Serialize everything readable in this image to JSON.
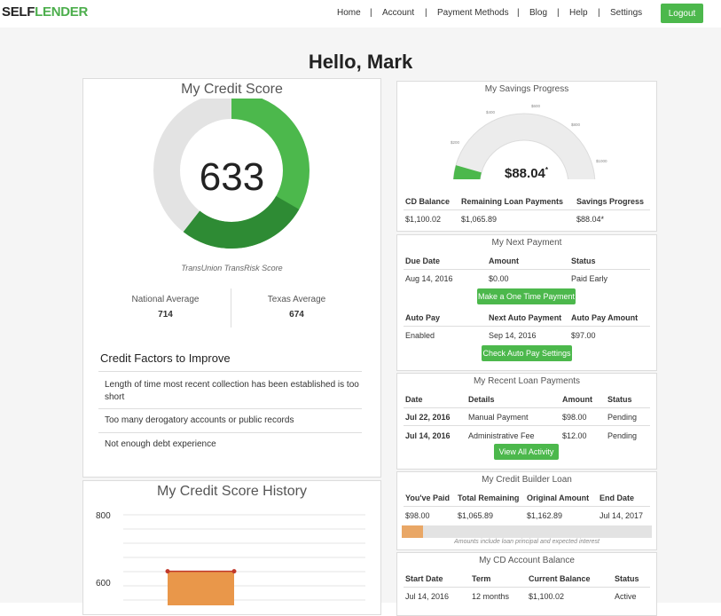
{
  "brand": {
    "part1": "SELF",
    "part2": "LENDER"
  },
  "nav": {
    "items": [
      "Home",
      "Account",
      "Payment Methods",
      "Blog",
      "Help",
      "Settings"
    ],
    "logout": "Logout"
  },
  "greeting": "Hello, Mark",
  "credit_score": {
    "title": "My Credit Score",
    "score": "633",
    "source": "TransUnion TransRisk Score",
    "national_label": "National Average",
    "national_value": "714",
    "texas_label": "Texas Average",
    "texas_value": "674",
    "factors_title": "Credit Factors to Improve",
    "factors": [
      "Length of time most recent collection has been established is too short",
      "Too many derogatory accounts or public records",
      "Not enough debt experience"
    ]
  },
  "history": {
    "title": "My Credit Score History",
    "y_labels": [
      "800",
      "600"
    ]
  },
  "chart_data": {
    "type": "line",
    "title": "My Credit Score History",
    "yticks": [
      800,
      600
    ],
    "series": [
      {
        "values": [
          633,
          633
        ]
      }
    ],
    "ylim": [
      590,
      800
    ]
  },
  "savings": {
    "title": "My Savings Progress",
    "gauge_value": "$88.04",
    "gauge_mark": "*",
    "gauge_ticks": [
      "$200",
      "$400",
      "$600",
      "$800",
      "$1000"
    ],
    "progress": 0.088,
    "headers": [
      "CD Balance",
      "Remaining Loan Payments",
      "Savings Progress"
    ],
    "values": [
      "$1,100.02",
      "$1,065.89",
      "$88.04*"
    ]
  },
  "next_payment": {
    "title": "My Next Payment",
    "headers": [
      "Due Date",
      "Amount",
      "Status"
    ],
    "values": [
      "Aug 14, 2016",
      "$0.00",
      "Paid Early"
    ],
    "button": "Make a One Time Payment",
    "headers2": [
      "Auto Pay",
      "Next Auto Payment",
      "Auto Pay Amount"
    ],
    "values2": [
      "Enabled",
      "Sep 14, 2016",
      "$97.00"
    ],
    "button2": "Check Auto Pay Settings"
  },
  "recent_payments": {
    "title": "My Recent Loan Payments",
    "headers": [
      "Date",
      "Details",
      "Amount",
      "Status"
    ],
    "rows": [
      [
        "Jul 22, 2016",
        "Manual Payment",
        "$98.00",
        "Pending"
      ],
      [
        "Jul 14, 2016",
        "Administrative Fee",
        "$12.00",
        "Pending"
      ]
    ],
    "button": "View All Activity"
  },
  "builder_loan": {
    "title": "My Credit Builder Loan",
    "headers": [
      "You've Paid",
      "Total Remaining",
      "Original Amount",
      "End Date"
    ],
    "values": [
      "$98.00",
      "$1,065.89",
      "$1,162.89",
      "Jul 14, 2017"
    ],
    "progress": 0.084,
    "note": "Amounts include loan principal and expected interest"
  },
  "cd_balance": {
    "title": "My CD Account Balance",
    "headers": [
      "Start Date",
      "Term",
      "Current Balance",
      "Status"
    ],
    "values": [
      "Jul 14, 2016",
      "12 months",
      "$1,100.02",
      "Active"
    ]
  },
  "colors": {
    "green": "#4cb84c",
    "dark_green": "#2e8b34",
    "orange": "#e9974a",
    "gray": "#e3e3e3"
  }
}
